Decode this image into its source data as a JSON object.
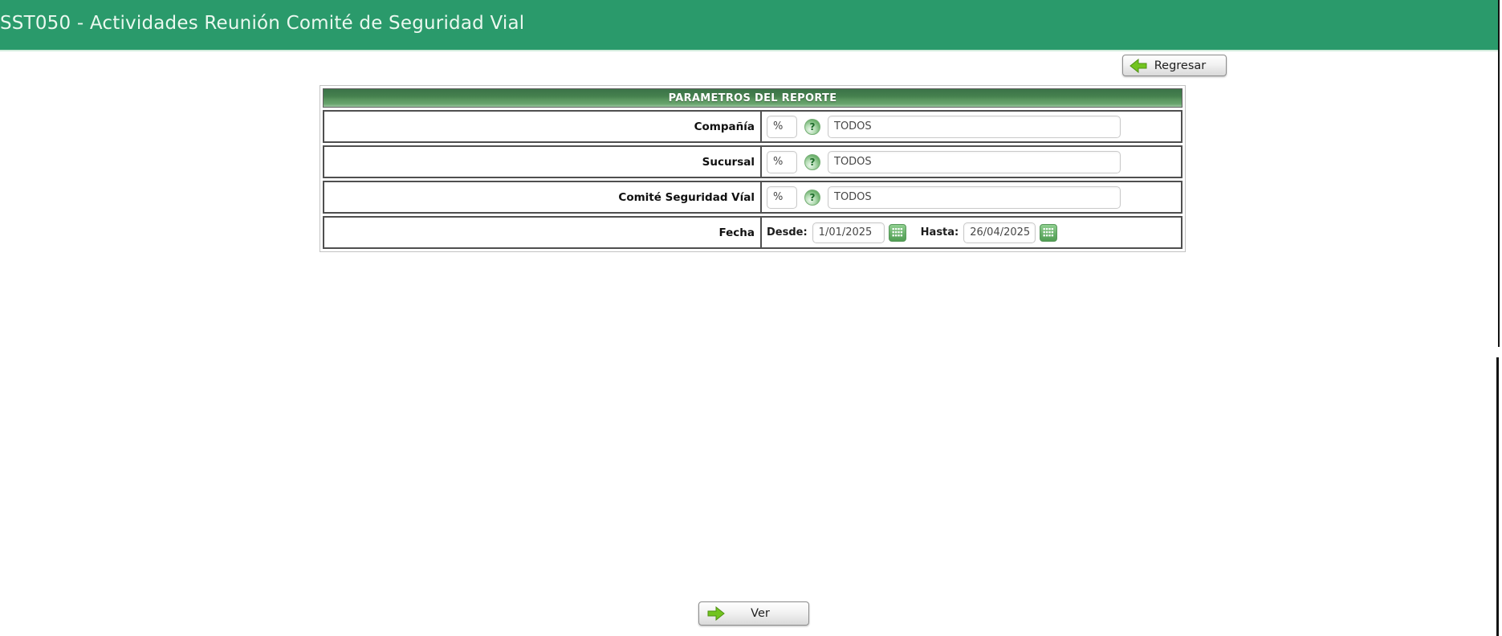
{
  "header": {
    "title": "SST050 - Actividades Reunión Comité de Seguridad Vial",
    "back_button_label": "Regresar"
  },
  "form": {
    "header_title": "PARAMETROS DEL REPORTE",
    "rows": [
      {
        "label": "Compañía",
        "filter": "%",
        "value": "TODOS"
      },
      {
        "label": "Sucursal",
        "filter": "%",
        "value": "TODOS"
      },
      {
        "label": "Comité Seguridad Víal",
        "filter": "%",
        "value": "TODOS"
      }
    ],
    "fecha": {
      "label": "Fecha",
      "desde_label": "Desde:",
      "desde_value": "1/01/2025",
      "hasta_label": "Hasta:",
      "hasta_value": "26/04/2025"
    }
  },
  "actions": {
    "ver_label": "Ver"
  },
  "icons": {
    "help_glyph": "?"
  },
  "colors": {
    "header_green": "#2a9a6b",
    "panel_header_green": "#4e8a57",
    "arrow_green": "#72c41f",
    "border_dark": "#4f4f4f"
  }
}
